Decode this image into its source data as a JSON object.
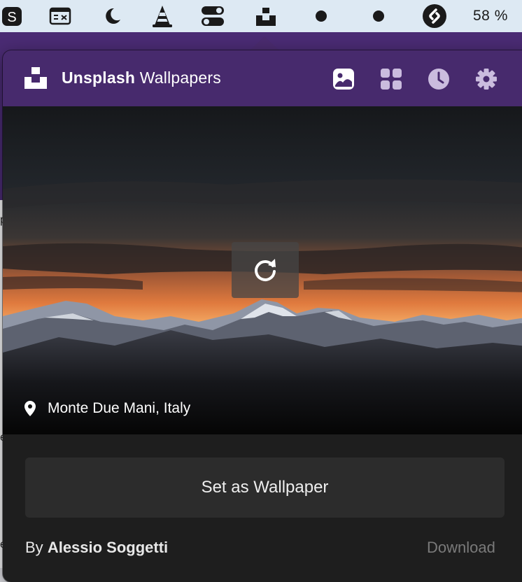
{
  "menubar": {
    "items": [
      "s-app-icon",
      "keyboard-shortcut-icon",
      "moon-icon",
      "vlc-cone-icon",
      "toggle-switches-icon",
      "unsplash-icon",
      "dot-icon",
      "dot-icon",
      "shazam-icon"
    ],
    "battery": "58 %"
  },
  "background": {
    "fragments": [
      "p",
      "e",
      "e"
    ]
  },
  "app": {
    "title_bold": "Unsplash",
    "title_rest": "Wallpapers",
    "header_icons": [
      "image-icon",
      "grid-icon",
      "history-clock-icon",
      "gear-icon"
    ],
    "accent": "#472a6d"
  },
  "photo": {
    "location": "Monte Due Mani, Italy",
    "refresh_icon": "refresh-icon"
  },
  "actions": {
    "set_wallpaper": "Set as Wallpaper",
    "by_prefix": "By",
    "author": "Alessio Soggetti",
    "download": "Download"
  }
}
